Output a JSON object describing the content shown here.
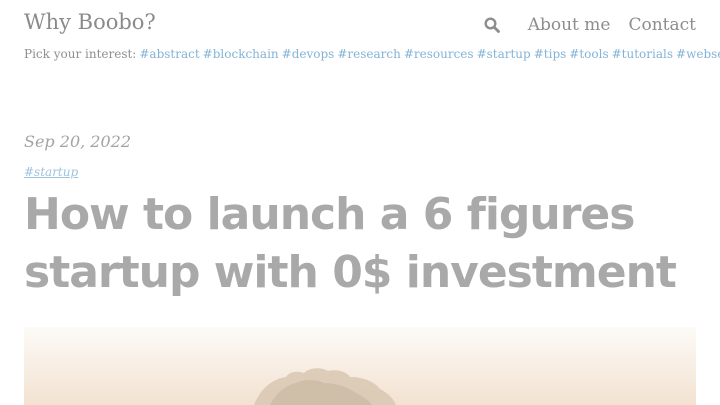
{
  "header": {
    "site_title": "Why Boobo?",
    "nav": [
      {
        "label": "About me"
      },
      {
        "label": "Contact"
      }
    ],
    "search_icon": "search-icon"
  },
  "interests": {
    "label": "Pick your interest:",
    "tags": [
      "#abstract",
      "#blockchain",
      "#devops",
      "#research",
      "#resources",
      "#startup",
      "#tips",
      "#tools",
      "#tutorials",
      "#webservice"
    ]
  },
  "post": {
    "date": "Sep 20, 2022",
    "tag": "#startup",
    "title": "How to launch a 6 figures startup with 0$ investment"
  },
  "colors": {
    "tag_link": "#84b3d6",
    "title_text": "#a9a9a9"
  }
}
